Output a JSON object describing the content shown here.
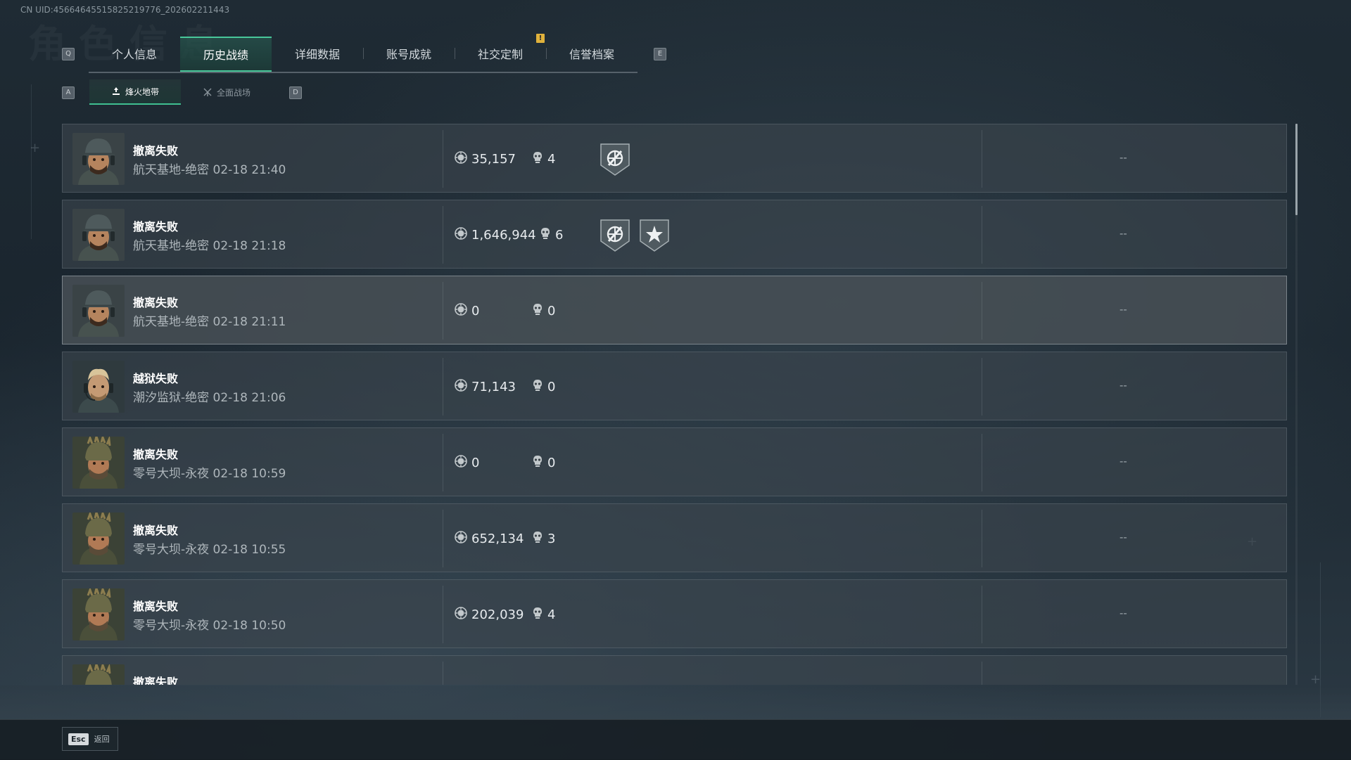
{
  "uid": "CN UID:4566464551582521977​6_202602211443",
  "watermark": "角色信息",
  "tabs": {
    "left_key": "Q",
    "right_key": "E",
    "items": [
      {
        "label": "个人信息"
      },
      {
        "label": "历史战绩"
      },
      {
        "label": "详细数据"
      },
      {
        "label": "账号成就"
      },
      {
        "label": "社交定制"
      },
      {
        "label": "信誉档案"
      }
    ],
    "active_index": 1,
    "notification": "!"
  },
  "subtabs": {
    "left_key": "A",
    "right_key": "D",
    "items": [
      {
        "label": "烽火地带",
        "icon": "flame-zone-icon"
      },
      {
        "label": "全面战场",
        "icon": "battlefield-icon"
      }
    ],
    "active_index": 0
  },
  "records": [
    {
      "result": "撤离失败",
      "detail": "航天基地-绝密 02-18 21:40",
      "value": "35,157",
      "kills": "4",
      "avatar": "soldier-cap",
      "medals": [
        "recycle-medal"
      ],
      "extra": "--"
    },
    {
      "result": "撤离失败",
      "detail": "航天基地-绝密 02-18 21:18",
      "value": "1,646,944",
      "kills": "6",
      "avatar": "soldier-cap",
      "medals": [
        "recycle-medal",
        "star-medal"
      ],
      "extra": "--"
    },
    {
      "result": "撤离失败",
      "detail": "航天基地-绝密 02-18 21:11",
      "value": "0",
      "kills": "0",
      "avatar": "soldier-cap",
      "medals": [],
      "extra": "--"
    },
    {
      "result": "越狱失败",
      "detail": "潮汐监狱-绝密 02-18 21:06",
      "value": "71,143",
      "kills": "0",
      "avatar": "soldier-headset",
      "medals": [],
      "extra": "--"
    },
    {
      "result": "撤离失败",
      "detail": "零号大坝-永夜 02-18 10:59",
      "value": "0",
      "kills": "0",
      "avatar": "soldier-helmet",
      "medals": [],
      "extra": "--"
    },
    {
      "result": "撤离失败",
      "detail": "零号大坝-永夜 02-18 10:55",
      "value": "652,134",
      "kills": "3",
      "avatar": "soldier-helmet",
      "medals": [],
      "extra": "--"
    },
    {
      "result": "撤离失败",
      "detail": "零号大坝-永夜 02-18 10:50",
      "value": "202,039",
      "kills": "4",
      "avatar": "soldier-helmet",
      "medals": [],
      "extra": "--"
    },
    {
      "result": "撤离失败",
      "detail": "",
      "value": "",
      "kills": "",
      "avatar": "soldier-helmet",
      "medals": [],
      "extra": ""
    }
  ],
  "footer": {
    "key": "Esc",
    "label": "返回"
  },
  "colors": {
    "accent": "#48c79a",
    "notification": "#e0b23c"
  }
}
